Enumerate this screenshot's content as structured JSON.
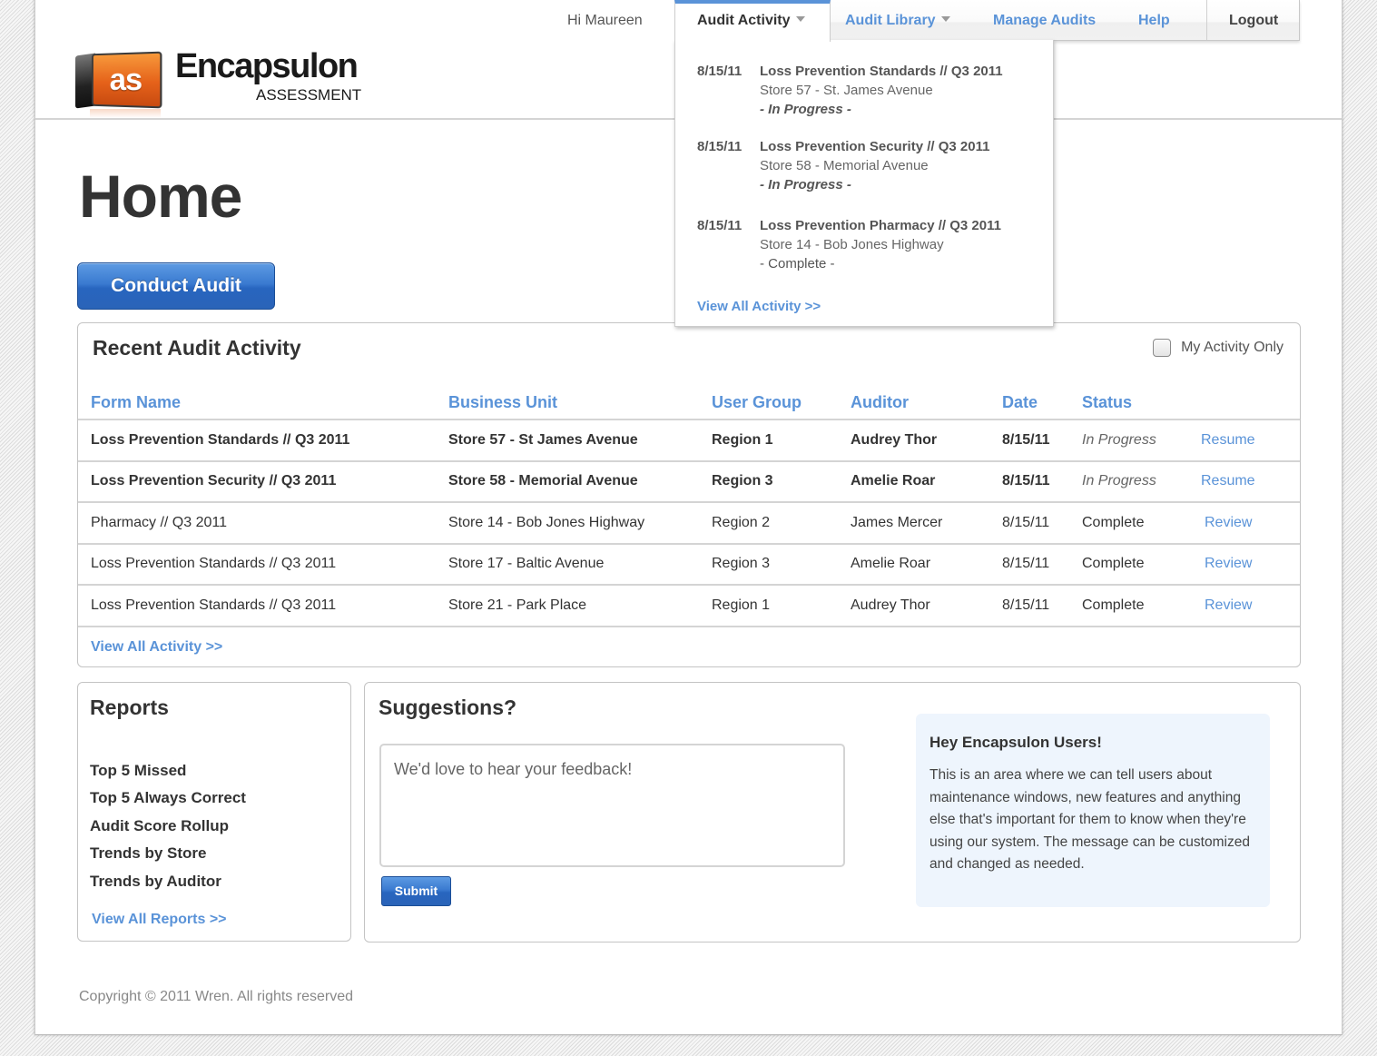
{
  "brand": {
    "logo_badge": "as",
    "name": "Encapsulon",
    "subtitle": "ASSESSMENT"
  },
  "nav": {
    "greeting": "Hi Maureen",
    "items": [
      {
        "label": "Audit Activity",
        "active": true,
        "has_dropdown": true
      },
      {
        "label": "Audit Library",
        "active": false,
        "has_dropdown": true
      },
      {
        "label": "Manage Audits",
        "active": false,
        "has_dropdown": false
      },
      {
        "label": "Help",
        "active": false,
        "has_dropdown": false
      }
    ],
    "logout": "Logout",
    "accent_color": "#5a93d8"
  },
  "dropdown": {
    "items": [
      {
        "date": "8/15/11",
        "title": "Loss Prevention Standards // Q3 2011",
        "store": "Store 57 - St. James Avenue",
        "status": "- In Progress -"
      },
      {
        "date": "8/15/11",
        "title": "Loss Prevention Security // Q3 2011",
        "store": "Store 58 - Memorial Avenue",
        "status": "- In Progress -"
      },
      {
        "date": "8/15/11",
        "title": "Loss Prevention Pharmacy // Q3 2011",
        "store": "Store 14 - Bob Jones Highway",
        "status": "- Complete -"
      }
    ],
    "view_all": "View All Activity >>"
  },
  "page": {
    "title": "Home",
    "conduct_audit": "Conduct Audit"
  },
  "recent": {
    "title": "Recent Audit Activity",
    "my_activity_label": "My Activity Only",
    "my_activity_checked": false,
    "columns": [
      "Form Name",
      "Business Unit",
      "User Group",
      "Auditor",
      "Date",
      "Status",
      ""
    ],
    "rows": [
      {
        "form": "Loss Prevention Standards  //  Q3 2011",
        "unit": "Store 57 - St James Avenue",
        "group": "Region 1",
        "auditor": "Audrey Thor",
        "date": "8/15/11",
        "status": "In Progress",
        "action": "Resume"
      },
      {
        "form": "Loss Prevention Security  //  Q3 2011",
        "unit": "Store 58 - Memorial Avenue",
        "group": "Region 3",
        "auditor": "Amelie Roar",
        "date": "8/15/11",
        "status": "In Progress",
        "action": "Resume"
      },
      {
        "form": "Pharmacy  //  Q3 2011",
        "unit": "Store 14 - Bob Jones Highway",
        "group": "Region 2",
        "auditor": "James Mercer",
        "date": "8/15/11",
        "status": "Complete",
        "action": "Review"
      },
      {
        "form": "Loss Prevention Standards  //  Q3 2011",
        "unit": "Store 17 - Baltic Avenue",
        "group": "Region 3",
        "auditor": "Amelie Roar",
        "date": "8/15/11",
        "status": "Complete",
        "action": "Review"
      },
      {
        "form": "Loss Prevention Standards  //  Q3 2011",
        "unit": "Store 21 - Park Place",
        "group": "Region 1",
        "auditor": "Audrey Thor",
        "date": "8/15/11",
        "status": "Complete",
        "action": "Review"
      }
    ],
    "view_all": "View All Activity >>"
  },
  "reports": {
    "title": "Reports",
    "items": [
      "Top 5 Missed",
      "Top 5 Always Correct",
      "Audit Score Rollup",
      "Trends by Store",
      "Trends by Auditor"
    ],
    "view_all": "View All Reports >>"
  },
  "suggestions": {
    "title": "Suggestions?",
    "placeholder": "We'd love to hear your feedback!",
    "value": "",
    "submit": "Submit"
  },
  "notice": {
    "title": "Hey Encapsulon Users!",
    "body": "This is an area where we can tell users about maintenance windows, new features and anything else that's important for them to know when they're using  our system. The message can be customized and changed as needed."
  },
  "footer": {
    "copyright": "Copyright © 2011 Wren. All rights reserved"
  }
}
